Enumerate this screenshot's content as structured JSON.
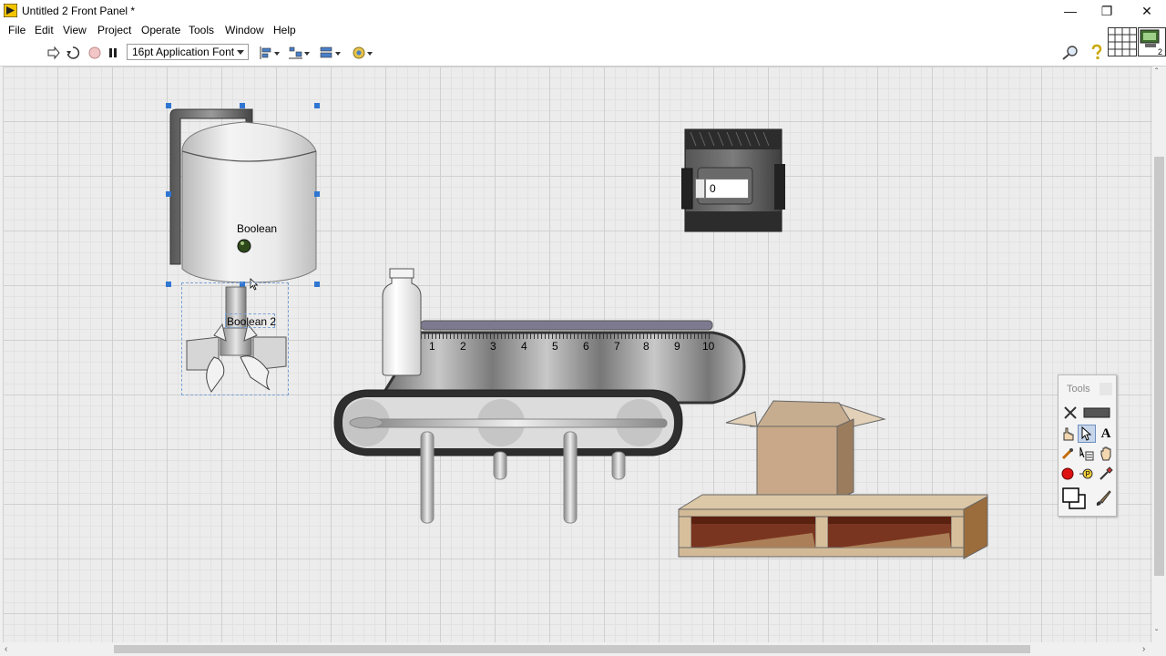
{
  "window": {
    "title": "Untitled 2 Front Panel *",
    "controls": {
      "minimize": "—",
      "maximize": "❐",
      "close": "✕"
    }
  },
  "menu": [
    "File",
    "Edit",
    "View",
    "Project",
    "Operate",
    "Tools",
    "Window",
    "Help"
  ],
  "toolbar": {
    "font": "16pt Application Font",
    "icons": [
      "run-arrow-icon",
      "run-continuously-icon",
      "abort-icon",
      "pause-icon",
      "align-objects-icon",
      "distribute-objects-icon",
      "resize-objects-icon",
      "reorder-icon",
      "search-icon",
      "help-icon"
    ],
    "connector_number": "2"
  },
  "panel": {
    "tank_label": "Boolean",
    "mixer_label": "Boolean 2",
    "numeric_value": "0",
    "conveyor_scale": [
      "1",
      "2",
      "3",
      "4",
      "5",
      "6",
      "7",
      "8",
      "9",
      "10"
    ]
  },
  "tools_palette": {
    "title": "Tools",
    "tools": [
      "automatic-tool-icon",
      "operate-value-icon",
      "position-size-select-icon",
      "edit-text-icon",
      "connect-wire-icon",
      "object-shortcut-menu-icon",
      "scroll-window-icon",
      "set-clear-breakpoint-icon",
      "probe-data-icon",
      "get-color-icon",
      "set-color-icon"
    ]
  },
  "colors": {
    "selection": "#2f76d2",
    "grid": "#d0d0d0",
    "box": "#c8a888",
    "pallet": "#d8c0a0"
  }
}
